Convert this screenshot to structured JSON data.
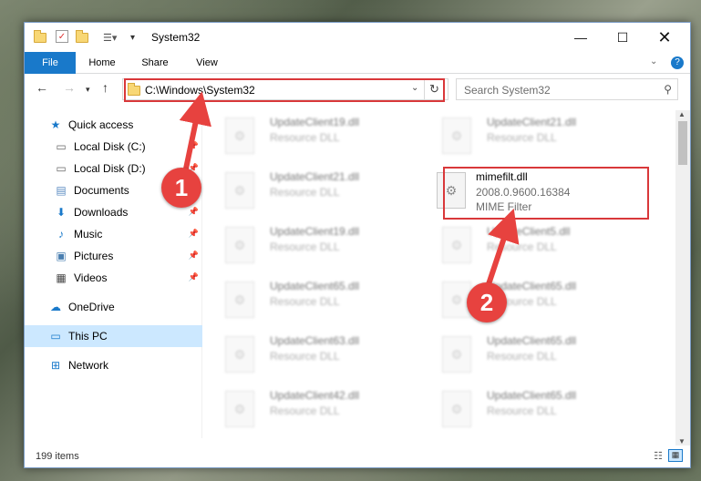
{
  "window": {
    "title": "System32"
  },
  "ribbon": {
    "tabs": [
      "File",
      "Home",
      "Share",
      "View"
    ]
  },
  "address": {
    "path": "C:\\Windows\\System32"
  },
  "search": {
    "placeholder": "Search System32"
  },
  "sidebar": {
    "items": [
      {
        "label": "Quick access",
        "icon": "star-icon"
      },
      {
        "label": "Local Disk (C:)",
        "icon": "drive-icon"
      },
      {
        "label": "Local Disk (D:)",
        "icon": "drive-icon"
      },
      {
        "label": "Documents",
        "icon": "documents-icon"
      },
      {
        "label": "Downloads",
        "icon": "download-icon"
      },
      {
        "label": "Music",
        "icon": "music-icon"
      },
      {
        "label": "Pictures",
        "icon": "pictures-icon"
      },
      {
        "label": "Videos",
        "icon": "videos-icon"
      },
      {
        "label": "OneDrive",
        "icon": "cloud-icon"
      },
      {
        "label": "This PC",
        "icon": "computer-icon"
      },
      {
        "label": "Network",
        "icon": "network-icon"
      }
    ]
  },
  "files": {
    "left": [
      {
        "name": "UpdateClient19.dll",
        "type": "Resource DLL"
      },
      {
        "name": "UpdateClient21.dll",
        "type": "Resource DLL"
      },
      {
        "name": "UpdateClient19.dll",
        "type": "Resource DLL"
      },
      {
        "name": "UpdateClient65.dll",
        "type": "Resource DLL"
      },
      {
        "name": "UpdateClient63.dll",
        "type": "Resource DLL"
      },
      {
        "name": "UpdateClient42.dll",
        "type": "Resource DLL"
      }
    ],
    "right": [
      {
        "name": "UpdateClient21.dll",
        "type": "Resource DLL"
      },
      {
        "name": "UpdateClient5.dll",
        "type": "Resource DLL"
      },
      {
        "name": "UpdateClient65.dll",
        "type": "Resource DLL"
      },
      {
        "name": "UpdateClient65.dll",
        "type": "Resource DLL"
      },
      {
        "name": "UpdateClient65.dll",
        "type": "Resource DLL"
      }
    ],
    "highlighted": {
      "name": "mimefilt.dll",
      "version": "2008.0.9600.16384",
      "description": "MIME Filter"
    }
  },
  "status": {
    "count": "199 items"
  },
  "annotations": {
    "badge1": "1",
    "badge2": "2"
  },
  "colors": {
    "accent": "#1979ca",
    "highlight": "#d9383a",
    "selected": "#cce8ff"
  }
}
